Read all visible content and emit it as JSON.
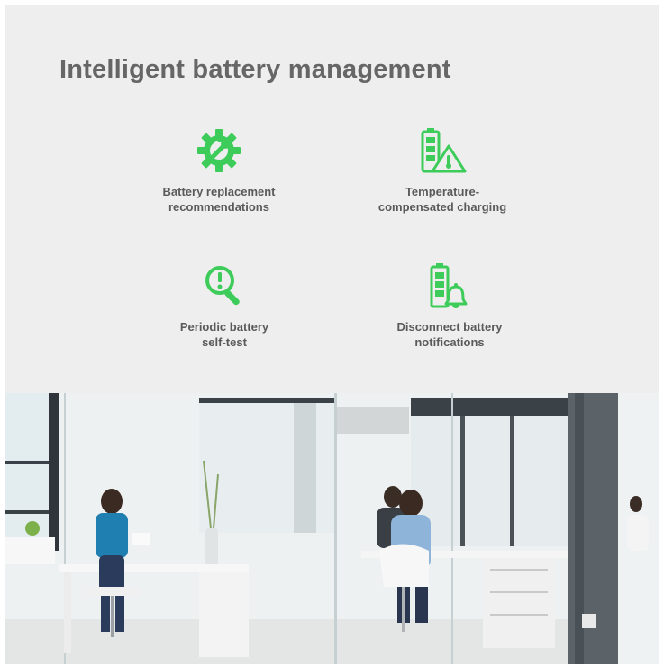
{
  "heading": "Intelligent battery management",
  "accent_color": "#3dcc5a",
  "features": [
    {
      "icon": "gear-wrench-icon",
      "line1": "Battery replacement",
      "line2": "recommendations"
    },
    {
      "icon": "battery-warning-icon",
      "line1": "Temperature-",
      "line2": "compensated charging"
    },
    {
      "icon": "magnifier-alert-icon",
      "line1": "Periodic battery",
      "line2": "self-test"
    },
    {
      "icon": "battery-bell-icon",
      "line1": "Disconnect battery",
      "line2": "notifications"
    }
  ],
  "photo": {
    "subject": "office-photo"
  }
}
